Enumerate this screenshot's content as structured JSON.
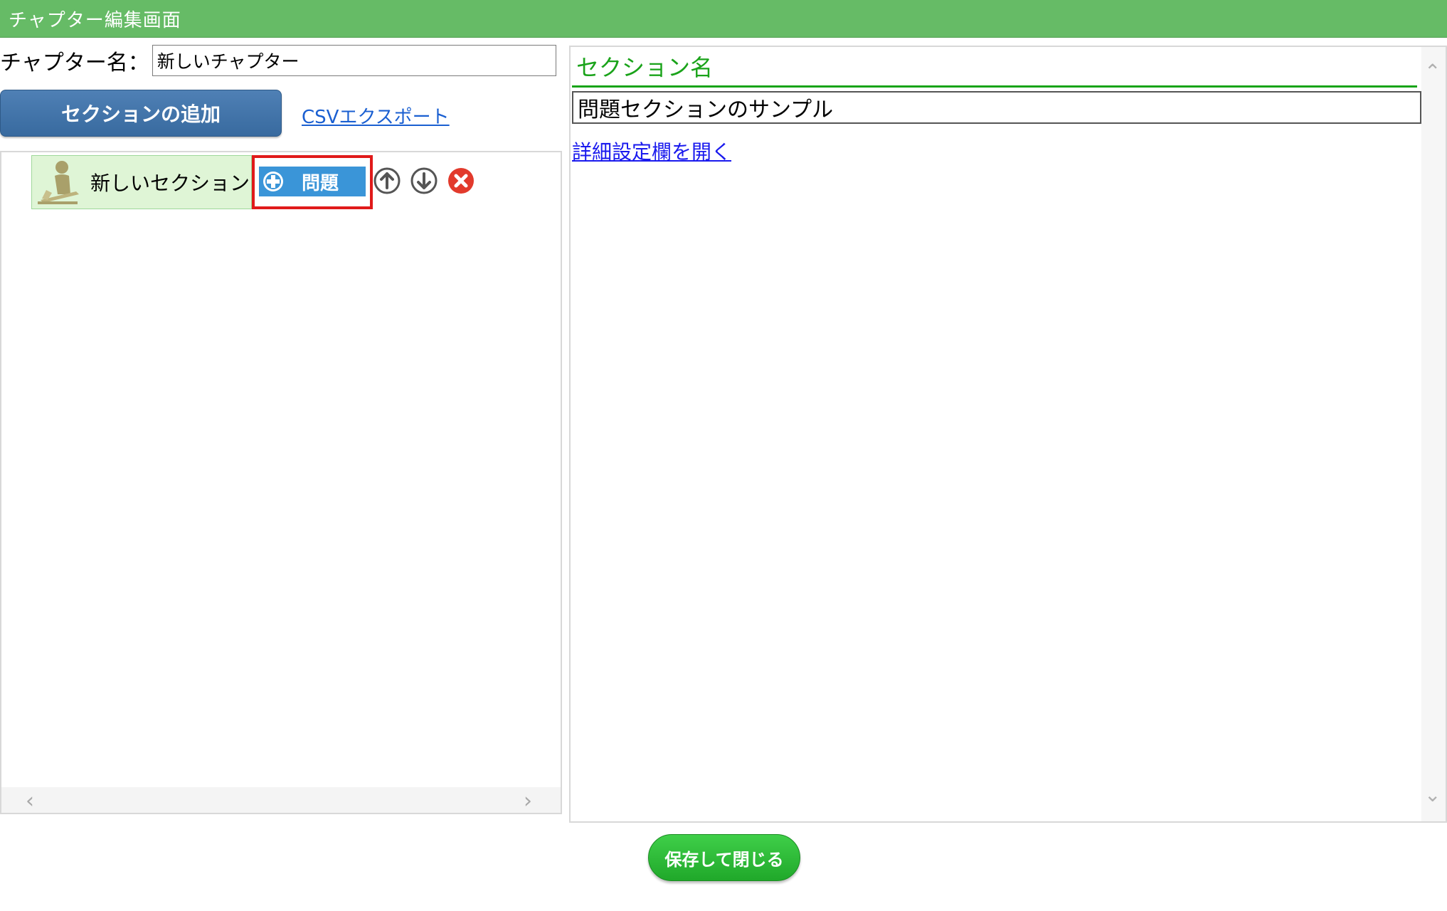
{
  "window": {
    "title": "チャプター編集画面",
    "title_bar_color": "#66bb66"
  },
  "chapter": {
    "label": "チャプター名：",
    "name_value": "新しいチャプター"
  },
  "toolbar": {
    "add_section_label": "セクションの追加",
    "csv_export_label": "CSVエクスポート"
  },
  "tree": {
    "section": {
      "label": "新しいセクション",
      "icon": "person-at-desk-icon"
    },
    "question_button_label": "問題",
    "move_up_icon": "arrow-up-circle-icon",
    "move_down_icon": "arrow-down-circle-icon",
    "delete_icon": "red-x-circle-icon",
    "highlight_color": "#e01a1a"
  },
  "detail": {
    "heading": "セクション名",
    "section_name_value": "問題セクションのサンプル",
    "open_advanced_link": "詳細設定欄を開く",
    "heading_color": "#1aa31a"
  },
  "footer": {
    "save_close_label": "保存して閉じる"
  },
  "colors": {
    "primary_button": "#4a7bb0",
    "question_button": "#3a95d8",
    "save_button": "#2db837"
  }
}
